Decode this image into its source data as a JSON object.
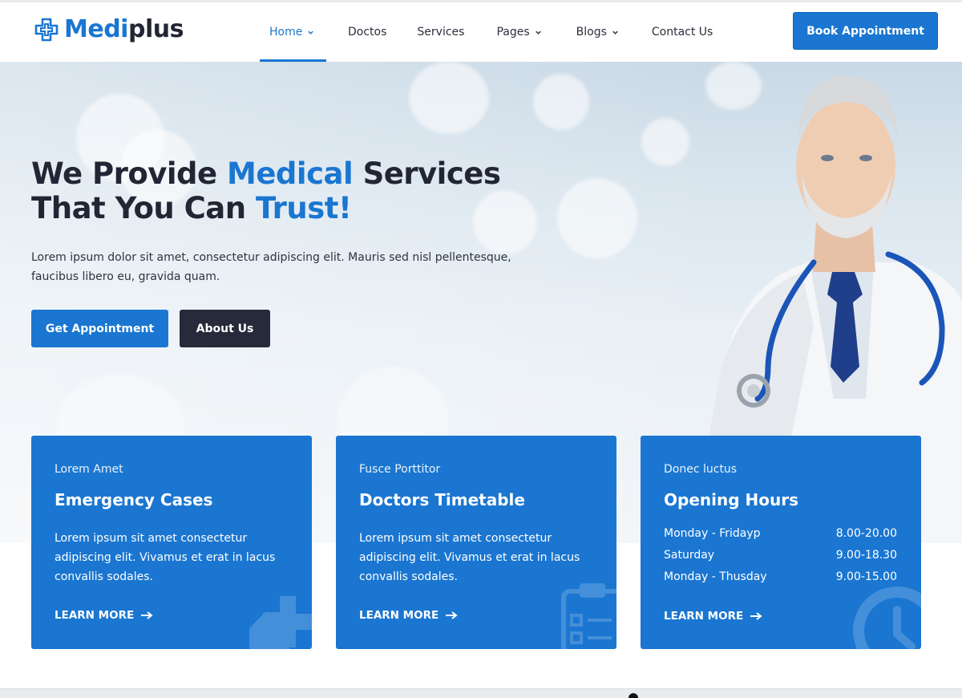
{
  "brand": {
    "name_part1": "Medi",
    "name_part2": "plus",
    "accent_color": "#1a76d1",
    "dark_color": "#222634",
    "logo_icon": "medical-cross-icon"
  },
  "nav": {
    "items": [
      {
        "label": "Home",
        "has_dropdown": true,
        "active": true
      },
      {
        "label": "Doctos",
        "has_dropdown": false
      },
      {
        "label": "Services",
        "has_dropdown": false
      },
      {
        "label": "Pages",
        "has_dropdown": true
      },
      {
        "label": "Blogs",
        "has_dropdown": true
      },
      {
        "label": "Contact Us",
        "has_dropdown": false
      }
    ],
    "cta_label": "Book Appointment"
  },
  "hero": {
    "title_line1_a": "We Provide ",
    "title_line1_accent": "Medical",
    "title_line1_b": " Services",
    "title_line2_a": "That You Can ",
    "title_line2_accent": "Trust!",
    "description": "Lorem ipsum dolor sit amet, consectetur adipiscing elit. Mauris sed nisl pellentesque, faucibus libero eu, gravida quam.",
    "primary_button": "Get Appointment",
    "secondary_button": "About Us"
  },
  "cards": [
    {
      "subtitle": "Lorem Amet",
      "title": "Emergency Cases",
      "text": "Lorem ipsum sit amet consectetur adipiscing elit. Vivamus et erat in lacus convallis sodales.",
      "link": "LEARN MORE",
      "icon": "ambulance-icon"
    },
    {
      "subtitle": "Fusce Porttitor",
      "title": "Doctors Timetable",
      "text": "Lorem ipsum sit amet consectetur adipiscing elit. Vivamus et erat in lacus convallis sodales.",
      "link": "LEARN MORE",
      "icon": "clipboard-icon"
    },
    {
      "subtitle": "Donec luctus",
      "title": "Opening Hours",
      "hours": [
        {
          "day": "Monday - Fridayp",
          "time": "8.00-20.00"
        },
        {
          "day": "Saturday",
          "time": "9.00-18.30"
        },
        {
          "day": "Monday - Thusday",
          "time": "9.00-15.00"
        }
      ],
      "link": "LEARN MORE",
      "icon": "clock-icon"
    }
  ]
}
